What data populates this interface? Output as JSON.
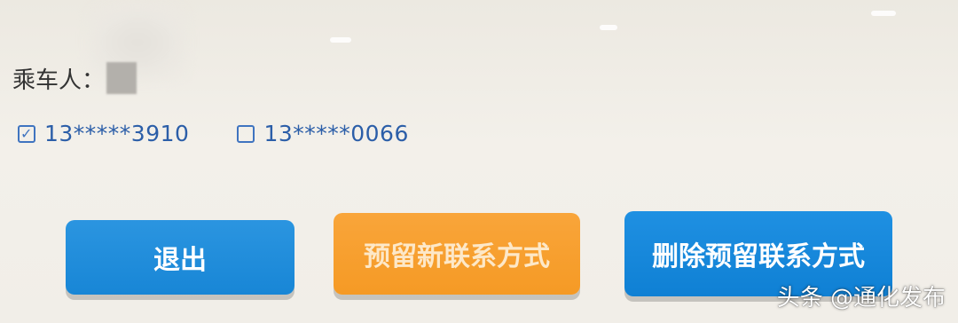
{
  "passenger": {
    "label": "乘车人："
  },
  "contacts": [
    {
      "phone": "13*****3910",
      "checked": true
    },
    {
      "phone": "13*****0066",
      "checked": false
    }
  ],
  "buttons": {
    "exit": "退出",
    "reserve_new": "预留新联系方式",
    "delete_reserved": "删除预留联系方式"
  },
  "watermark": "头条 @通化发布",
  "colors": {
    "exit_button": "#1886d6",
    "reserve_button": "#f59a25",
    "delete_button": "#0f80d4",
    "phone_text": "#2b5ea8"
  }
}
